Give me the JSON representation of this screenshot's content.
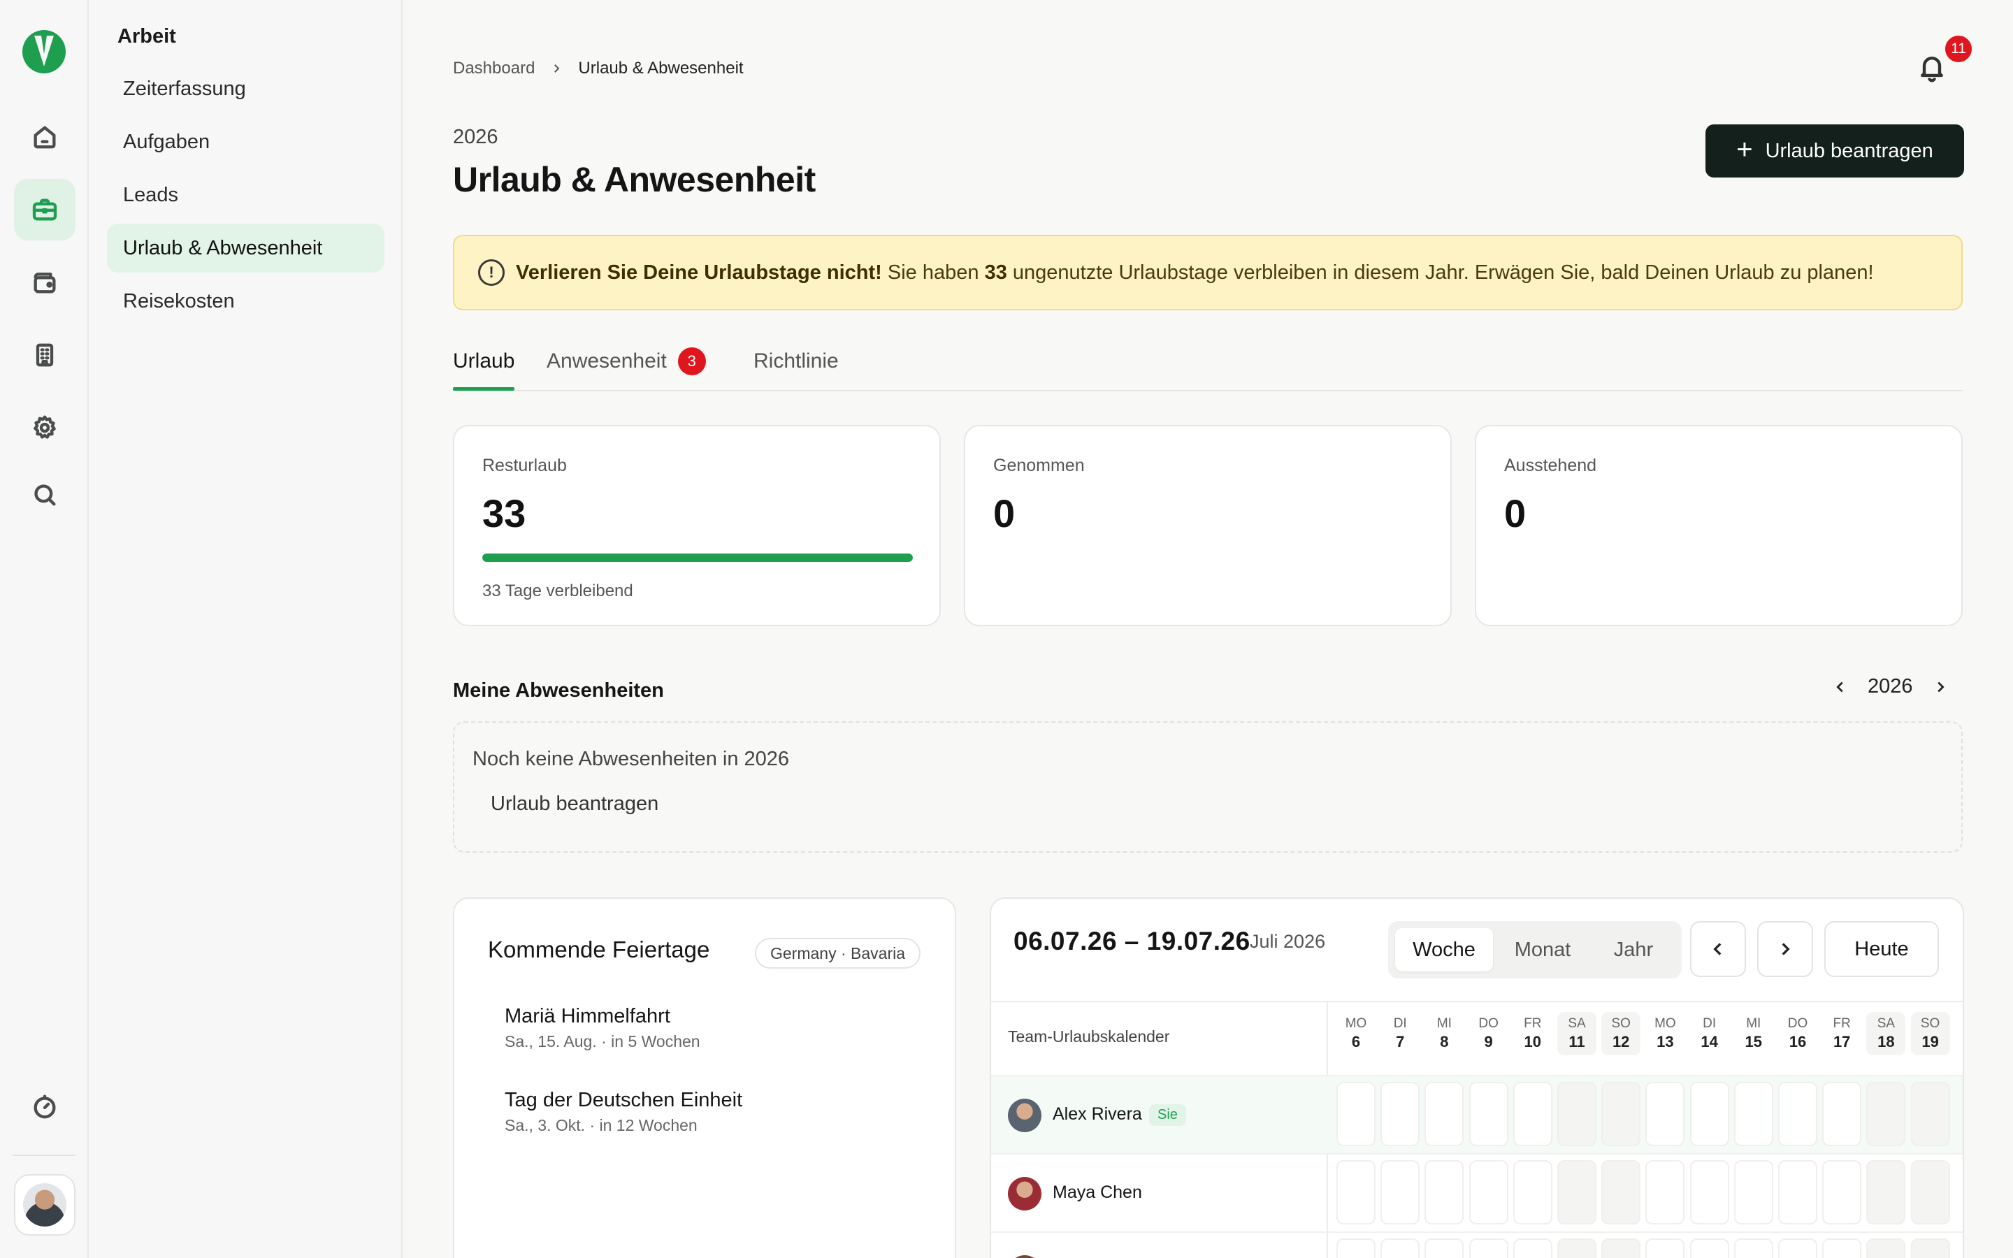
{
  "rail": {
    "items": [
      {
        "name": "home-icon",
        "active": false
      },
      {
        "name": "briefcase-icon",
        "active": true
      },
      {
        "name": "wallet-icon",
        "active": false
      },
      {
        "name": "building-icon",
        "active": false
      },
      {
        "name": "settings-icon",
        "active": false
      },
      {
        "name": "search-icon",
        "active": false
      }
    ],
    "bottom_icon": "timer-icon"
  },
  "subnav": {
    "title": "Arbeit",
    "items": [
      {
        "label": "Zeiterfassung",
        "active": false
      },
      {
        "label": "Aufgaben",
        "active": false
      },
      {
        "label": "Leads",
        "active": false
      },
      {
        "label": "Urlaub & Abwesenheit",
        "active": true
      },
      {
        "label": "Reisekosten",
        "active": false
      }
    ]
  },
  "header": {
    "breadcrumb": [
      "Dashboard",
      "Urlaub & Abwesenheit"
    ],
    "notification_count": "11",
    "year": "2026",
    "title": "Urlaub & Anwesenheit",
    "primary_button": "Urlaub beantragen"
  },
  "alert": {
    "bold": "Verlieren Sie Deine Urlaubstage nicht!",
    "pre": "Sie haben",
    "count": "33",
    "post": "ungenutzte Urlaubstage verbleiben in diesem Jahr. Erwägen Sie, bald Deinen Urlaub zu planen!"
  },
  "tabs": [
    {
      "label": "Urlaub",
      "active": true,
      "badge": ""
    },
    {
      "label": "Anwesenheit",
      "active": false,
      "badge": "3"
    },
    {
      "label": "Richtlinie",
      "active": false,
      "badge": ""
    }
  ],
  "stats": [
    {
      "label": "Resturlaub",
      "value": "33",
      "progress_fraction": 1.0,
      "sub": "33 Tage verbleibend"
    },
    {
      "label": "Genommen",
      "value": "0"
    },
    {
      "label": "Ausstehend",
      "value": "0"
    }
  ],
  "absences": {
    "title": "Meine Abwesenheiten",
    "year": "2026",
    "empty_text": "Noch keine Abwesenheiten in 2026",
    "empty_link": "Urlaub beantragen"
  },
  "holidays": {
    "title": "Kommende Feiertage",
    "region": "Germany · Bavaria",
    "items": [
      {
        "name": "Mariä Himmelfahrt",
        "meta": "Sa., 15. Aug. · in 5 Wochen"
      },
      {
        "name": "Tag der Deutschen Einheit",
        "meta": "Sa., 3. Okt. · in 12 Wochen"
      }
    ]
  },
  "calendar": {
    "range": "06.07.26 – 19.07.26",
    "month": "Juli 2026",
    "views": [
      "Woche",
      "Monat",
      "Jahr"
    ],
    "active_view": "Woche",
    "today_label": "Heute",
    "row_header": "Team-Urlaubskalender",
    "days": [
      {
        "dn": "MO",
        "dd": "6",
        "weekend": false
      },
      {
        "dn": "DI",
        "dd": "7",
        "weekend": false
      },
      {
        "dn": "MI",
        "dd": "8",
        "weekend": false
      },
      {
        "dn": "DO",
        "dd": "9",
        "weekend": false
      },
      {
        "dn": "FR",
        "dd": "10",
        "weekend": false
      },
      {
        "dn": "SA",
        "dd": "11",
        "weekend": true
      },
      {
        "dn": "SO",
        "dd": "12",
        "weekend": true
      },
      {
        "dn": "MO",
        "dd": "13",
        "weekend": false
      },
      {
        "dn": "DI",
        "dd": "14",
        "weekend": false
      },
      {
        "dn": "MI",
        "dd": "15",
        "weekend": false
      },
      {
        "dn": "DO",
        "dd": "16",
        "weekend": false
      },
      {
        "dn": "FR",
        "dd": "17",
        "weekend": false
      },
      {
        "dn": "SA",
        "dd": "18",
        "weekend": true
      },
      {
        "dn": "SO",
        "dd": "19",
        "weekend": true
      }
    ],
    "members": [
      {
        "name": "Alex Rivera",
        "you_label": "Sie",
        "is_me": true,
        "avatar_color": "#5a6470"
      },
      {
        "name": "Maya Chen",
        "you_label": "",
        "is_me": false,
        "avatar_color": "#9b2b34"
      },
      {
        "name": "",
        "you_label": "",
        "is_me": false,
        "avatar_color": "#6b4a3a"
      }
    ]
  }
}
